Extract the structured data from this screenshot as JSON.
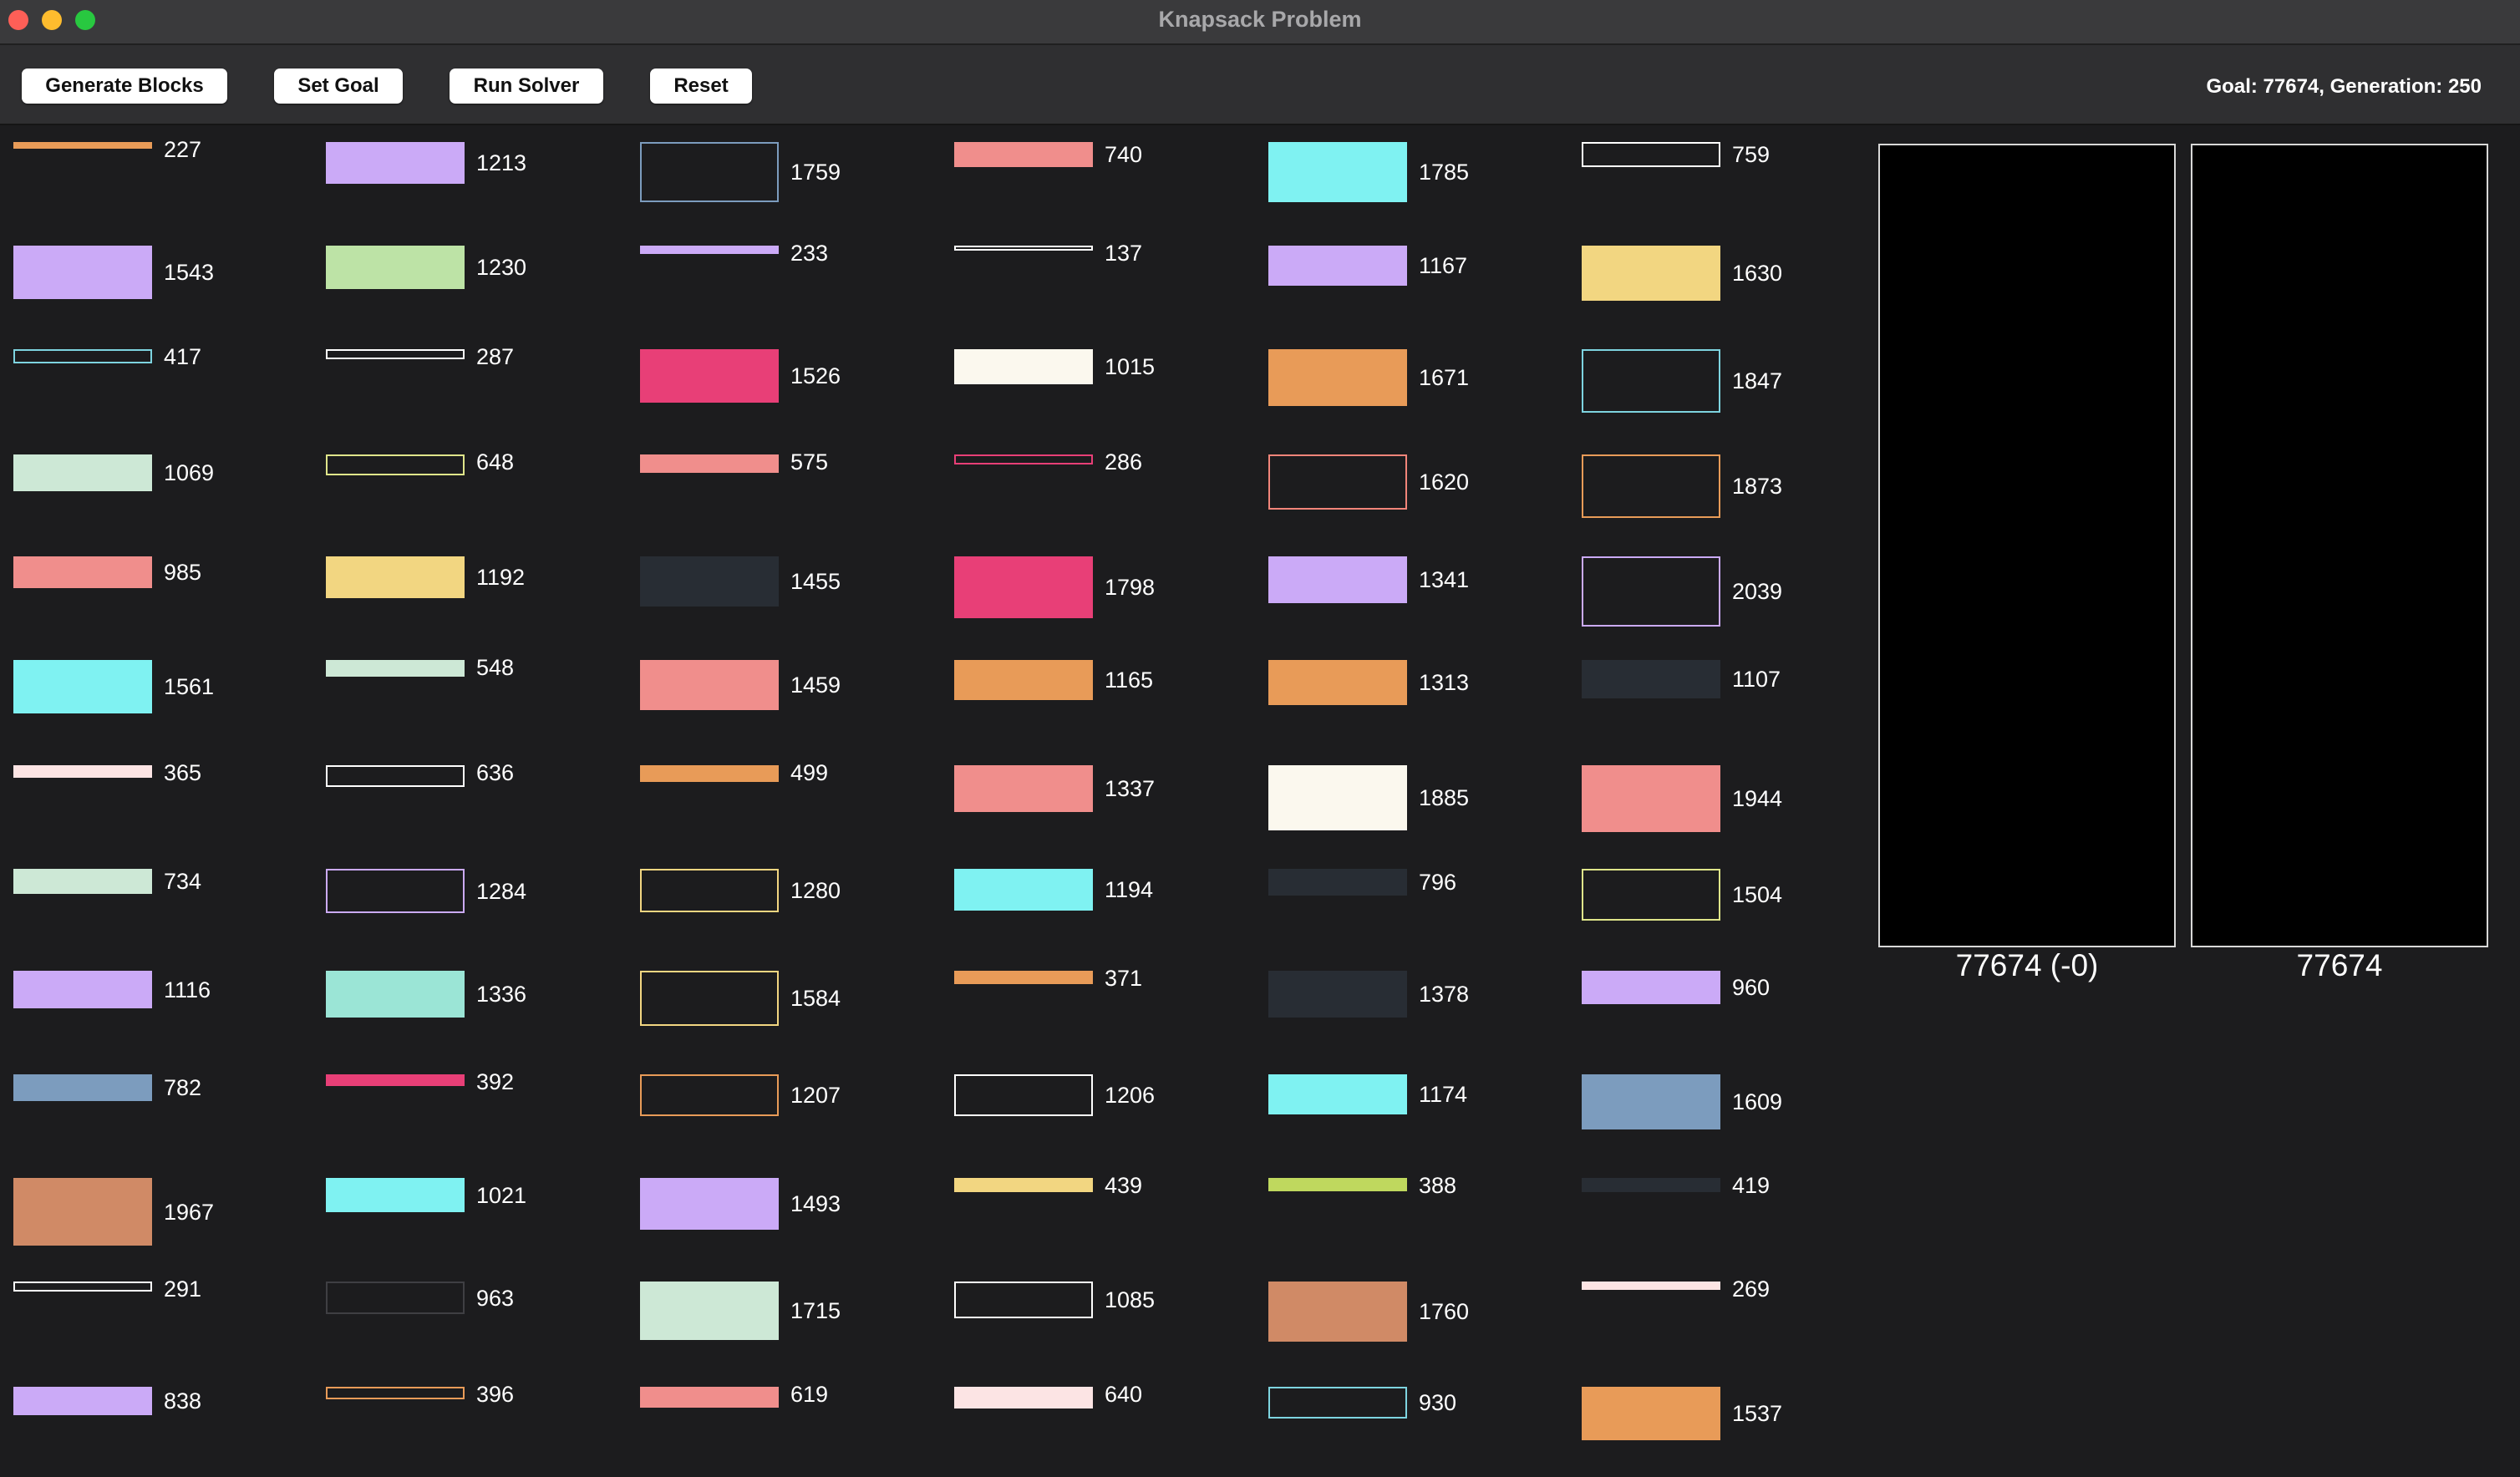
{
  "window": {
    "title": "Knapsack Problem",
    "controls": [
      {
        "name": "close",
        "color": "#fe5f57"
      },
      {
        "name": "minimize",
        "color": "#febc2e"
      },
      {
        "name": "maximize",
        "color": "#28c840"
      }
    ]
  },
  "toolbar": {
    "generate_label": "Generate Blocks",
    "set_goal_label": "Set Goal",
    "run_solver_label": "Run Solver",
    "reset_label": "Reset",
    "status": "Goal: 77674, Generation: 250"
  },
  "palette": {
    "orange": "#e89b58",
    "lavender": "#cbaaf7",
    "green": "#bde3a6",
    "lightblue": "#7ed4e0",
    "cyan": "#7ff2f2",
    "mint": "#cde8d6",
    "salmon": "#f08e8c",
    "pink": "#e83f77",
    "cream": "#fbf8ee",
    "yellow": "#f2d681",
    "white": "#ffffff",
    "lime": "#dfe58a",
    "dark": "#282d34",
    "teal": "#9be5d6",
    "rose": "#fce4e4",
    "steel": "#7c9cbe",
    "brown": "#d08a66",
    "gray": "#3f3f43",
    "limegreen": "#bfd85e",
    "coral": "#f2857a"
  },
  "columns": [
    [
      {
        "weight": "227",
        "color": "orange",
        "style": "fill",
        "height": 8
      },
      {
        "weight": "1543",
        "color": "lavender",
        "style": "fill",
        "height": 64
      },
      {
        "weight": "417",
        "color": "lightblue",
        "style": "outline",
        "height": 17
      },
      {
        "weight": "1069",
        "color": "mint",
        "style": "fill",
        "height": 44
      },
      {
        "weight": "985",
        "color": "salmon",
        "style": "fill",
        "height": 38
      },
      {
        "weight": "1561",
        "color": "cyan",
        "style": "fill",
        "height": 64
      },
      {
        "weight": "365",
        "color": "rose",
        "style": "fill",
        "height": 15
      },
      {
        "weight": "734",
        "color": "mint",
        "style": "fill",
        "height": 30
      },
      {
        "weight": "1116",
        "color": "lavender",
        "style": "fill",
        "height": 45
      },
      {
        "weight": "782",
        "color": "steel",
        "style": "fill",
        "height": 32
      },
      {
        "weight": "1967",
        "color": "brown",
        "style": "fill",
        "height": 81
      },
      {
        "weight": "291",
        "color": "white",
        "style": "outline",
        "height": 12
      },
      {
        "weight": "838",
        "color": "lavender",
        "style": "fill",
        "height": 34
      }
    ],
    [
      {
        "weight": "1213",
        "color": "lavender",
        "style": "fill",
        "height": 50
      },
      {
        "weight": "1230",
        "color": "green",
        "style": "fill",
        "height": 52
      },
      {
        "weight": "287",
        "color": "white",
        "style": "outline",
        "height": 12
      },
      {
        "weight": "648",
        "color": "lime",
        "style": "outline",
        "height": 25
      },
      {
        "weight": "1192",
        "color": "yellow",
        "style": "fill",
        "height": 50
      },
      {
        "weight": "548",
        "color": "mint",
        "style": "fill",
        "height": 20
      },
      {
        "weight": "636",
        "color": "white",
        "style": "outline",
        "height": 26
      },
      {
        "weight": "1284",
        "color": "lavender",
        "style": "outline",
        "height": 53
      },
      {
        "weight": "1336",
        "color": "teal",
        "style": "fill",
        "height": 56
      },
      {
        "weight": "392",
        "color": "pink",
        "style": "fill",
        "height": 14
      },
      {
        "weight": "1021",
        "color": "cyan",
        "style": "fill",
        "height": 41
      },
      {
        "weight": "963",
        "color": "gray",
        "style": "outline",
        "height": 39
      },
      {
        "weight": "396",
        "color": "orange",
        "style": "outline",
        "height": 15
      }
    ],
    [
      {
        "weight": "1759",
        "color": "steel",
        "style": "outline",
        "height": 72
      },
      {
        "weight": "233",
        "color": "lavender",
        "style": "fill",
        "height": 10
      },
      {
        "weight": "1526",
        "color": "pink",
        "style": "fill",
        "height": 64
      },
      {
        "weight": "575",
        "color": "salmon",
        "style": "fill",
        "height": 22
      },
      {
        "weight": "1455",
        "color": "dark",
        "style": "fill",
        "height": 60
      },
      {
        "weight": "1459",
        "color": "salmon",
        "style": "fill",
        "height": 60
      },
      {
        "weight": "499",
        "color": "orange",
        "style": "fill",
        "height": 20
      },
      {
        "weight": "1280",
        "color": "yellow",
        "style": "outline",
        "height": 52
      },
      {
        "weight": "1584",
        "color": "yellow",
        "style": "outline",
        "height": 66
      },
      {
        "weight": "1207",
        "color": "orange",
        "style": "outline",
        "height": 50
      },
      {
        "weight": "1493",
        "color": "lavender",
        "style": "fill",
        "height": 62
      },
      {
        "weight": "1715",
        "color": "mint",
        "style": "fill",
        "height": 70
      },
      {
        "weight": "619",
        "color": "salmon",
        "style": "fill",
        "height": 25
      }
    ],
    [
      {
        "weight": "740",
        "color": "salmon",
        "style": "fill",
        "height": 30
      },
      {
        "weight": "137",
        "color": "white",
        "style": "outline",
        "height": 6
      },
      {
        "weight": "1015",
        "color": "cream",
        "style": "fill",
        "height": 42
      },
      {
        "weight": "286",
        "color": "pink",
        "style": "outline",
        "height": 12
      },
      {
        "weight": "1798",
        "color": "pink",
        "style": "fill",
        "height": 74
      },
      {
        "weight": "1165",
        "color": "orange",
        "style": "fill",
        "height": 48
      },
      {
        "weight": "1337",
        "color": "salmon",
        "style": "fill",
        "height": 56
      },
      {
        "weight": "1194",
        "color": "cyan",
        "style": "fill",
        "height": 50
      },
      {
        "weight": "371",
        "color": "orange",
        "style": "fill",
        "height": 16
      },
      {
        "weight": "1206",
        "color": "white",
        "style": "outline",
        "height": 50
      },
      {
        "weight": "439",
        "color": "yellow",
        "style": "fill",
        "height": 17
      },
      {
        "weight": "1085",
        "color": "white",
        "style": "outline",
        "height": 44
      },
      {
        "weight": "640",
        "color": "rose",
        "style": "fill",
        "height": 26
      }
    ],
    [
      {
        "weight": "1785",
        "color": "cyan",
        "style": "fill",
        "height": 72
      },
      {
        "weight": "1167",
        "color": "lavender",
        "style": "fill",
        "height": 48
      },
      {
        "weight": "1671",
        "color": "orange",
        "style": "fill",
        "height": 68
      },
      {
        "weight": "1620",
        "color": "coral",
        "style": "outline",
        "height": 66
      },
      {
        "weight": "1341",
        "color": "lavender",
        "style": "fill",
        "height": 56
      },
      {
        "weight": "1313",
        "color": "orange",
        "style": "fill",
        "height": 54
      },
      {
        "weight": "1885",
        "color": "cream",
        "style": "fill",
        "height": 78
      },
      {
        "weight": "796",
        "color": "dark",
        "style": "fill",
        "height": 32
      },
      {
        "weight": "1378",
        "color": "dark",
        "style": "fill",
        "height": 56
      },
      {
        "weight": "1174",
        "color": "cyan",
        "style": "fill",
        "height": 48
      },
      {
        "weight": "388",
        "color": "limegreen",
        "style": "fill",
        "height": 16
      },
      {
        "weight": "1760",
        "color": "brown",
        "style": "fill",
        "height": 72
      },
      {
        "weight": "930",
        "color": "lightblue",
        "style": "outline",
        "height": 38
      }
    ],
    [
      {
        "weight": "759",
        "color": "white",
        "style": "outline",
        "height": 30
      },
      {
        "weight": "1630",
        "color": "yellow",
        "style": "fill",
        "height": 66
      },
      {
        "weight": "1847",
        "color": "lightblue",
        "style": "outline",
        "height": 76
      },
      {
        "weight": "1873",
        "color": "orange",
        "style": "outline",
        "height": 76
      },
      {
        "weight": "2039",
        "color": "lavender",
        "style": "outline",
        "height": 84
      },
      {
        "weight": "1107",
        "color": "dark",
        "style": "fill",
        "height": 46
      },
      {
        "weight": "1944",
        "color": "salmon",
        "style": "fill",
        "height": 80
      },
      {
        "weight": "1504",
        "color": "lime",
        "style": "outline",
        "height": 62
      },
      {
        "weight": "960",
        "color": "lavender",
        "style": "fill",
        "height": 40
      },
      {
        "weight": "1609",
        "color": "steel",
        "style": "fill",
        "height": 66
      },
      {
        "weight": "419",
        "color": "dark",
        "style": "fill",
        "height": 17
      },
      {
        "weight": "269",
        "color": "rose",
        "style": "fill",
        "height": 10
      },
      {
        "weight": "1537",
        "color": "orange",
        "style": "fill",
        "height": 64
      }
    ]
  ],
  "panels": {
    "current_label": "77674 (-0)",
    "goal_label": "77674"
  }
}
